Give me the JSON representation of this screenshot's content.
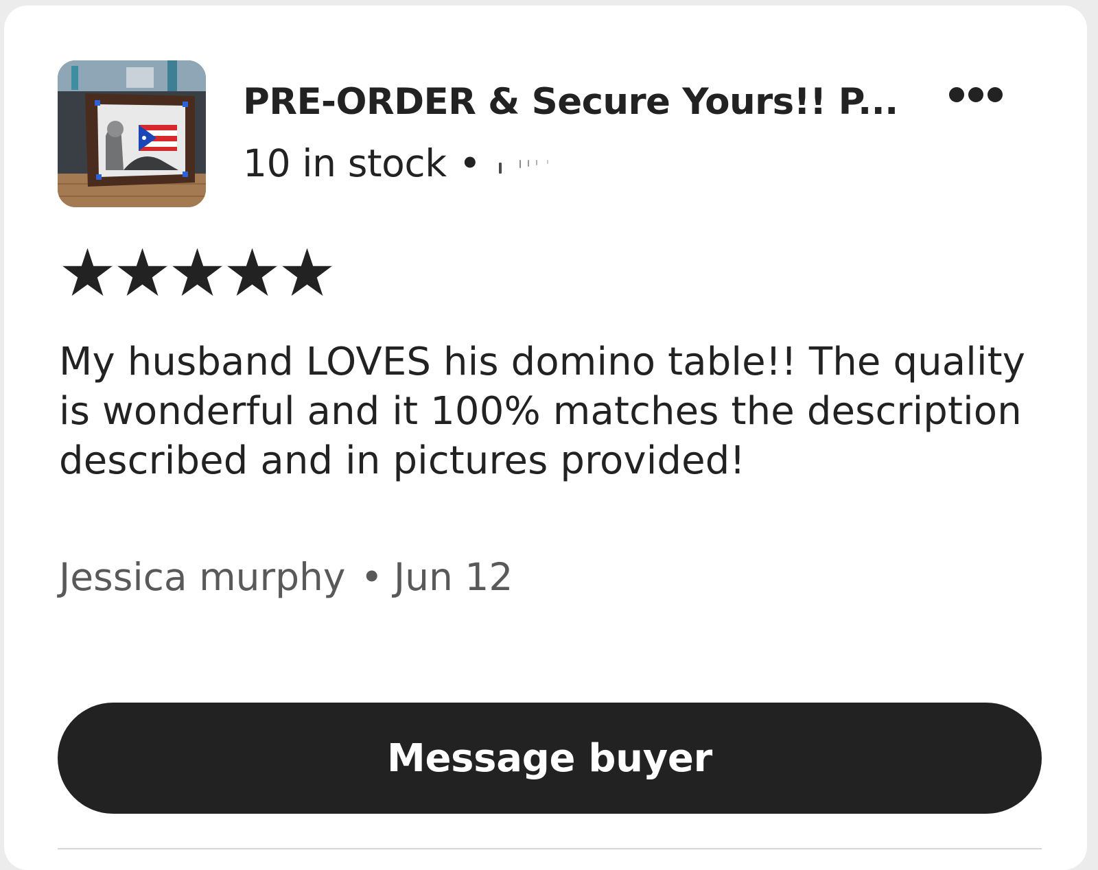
{
  "listing": {
    "title": "PRE-ORDER & Secure Yours!! P...",
    "stock": "10 in stock",
    "separator": "•",
    "thumbnail_icon": "domino-table-photo"
  },
  "menu": {
    "icon": "more-horizontal-icon"
  },
  "rating": {
    "stars": 5,
    "max": 5,
    "star_icon": "star-filled-icon"
  },
  "review": {
    "text": "My husband LOVES his domino table!! The quality is wonderful and it 100% matches the description described and in pictures provided!"
  },
  "byline": {
    "author": "Jessica murphy",
    "separator": "•",
    "date": "Jun 12"
  },
  "actions": {
    "message_buyer_label": "Message buyer"
  },
  "colors": {
    "text": "#222222",
    "muted": "#595959",
    "button_bg": "#222222",
    "button_text": "#ffffff",
    "card_bg": "#ffffff",
    "page_bg": "#ececec"
  }
}
